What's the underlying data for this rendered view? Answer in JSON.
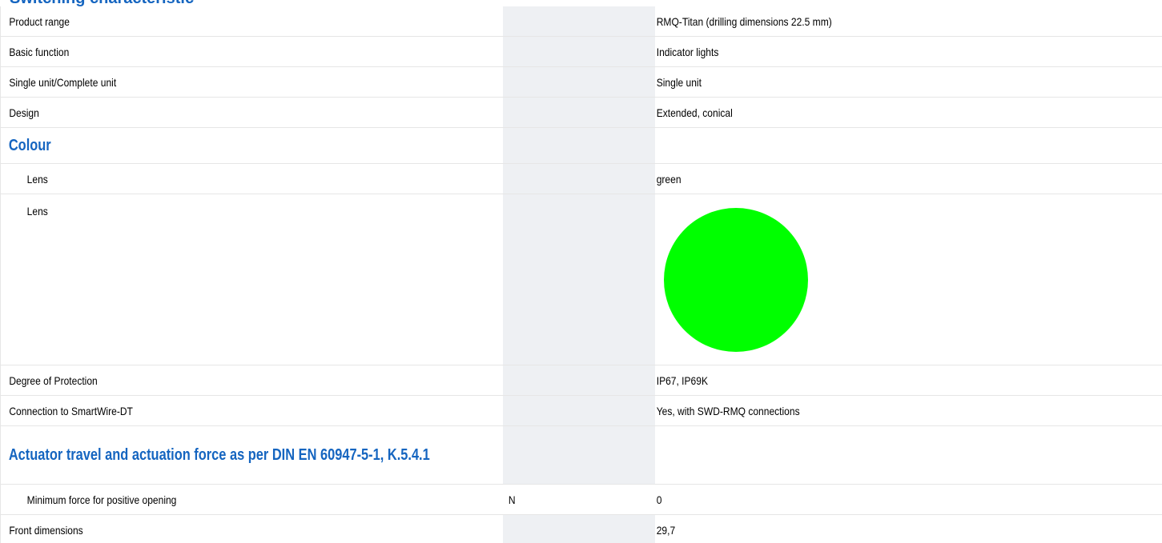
{
  "top_heading": "Switching characteristic",
  "rows": [
    {
      "name": "Product range",
      "unit": "",
      "value": "RMQ-Titan (drilling dimensions 22.5 mm)"
    },
    {
      "name": "Basic function",
      "unit": "",
      "value": "Indicator lights"
    },
    {
      "name": "Single unit/Complete unit",
      "unit": "",
      "value": "Single unit"
    },
    {
      "name": "Design",
      "unit": "",
      "value": "Extended, conical"
    },
    {
      "section": "Colour"
    },
    {
      "name": "Lens",
      "unit": "",
      "value": "green"
    },
    {
      "name": "Lens",
      "unit": "",
      "swatch_color": "#00ff00"
    },
    {
      "name": "Degree of Protection",
      "unit": "",
      "value": "IP67, IP69K"
    },
    {
      "name": "Connection to SmartWire-DT",
      "unit": "",
      "value": "Yes, with SWD-RMQ connections"
    },
    {
      "section": "Actuator travel and actuation force as per DIN EN 60947-5-1, K.5.4.1"
    },
    {
      "name": "Minimum force for positive opening",
      "unit": "N",
      "value": "0"
    },
    {
      "name": "Front dimensions",
      "unit": "",
      "value": "29,7"
    }
  ]
}
